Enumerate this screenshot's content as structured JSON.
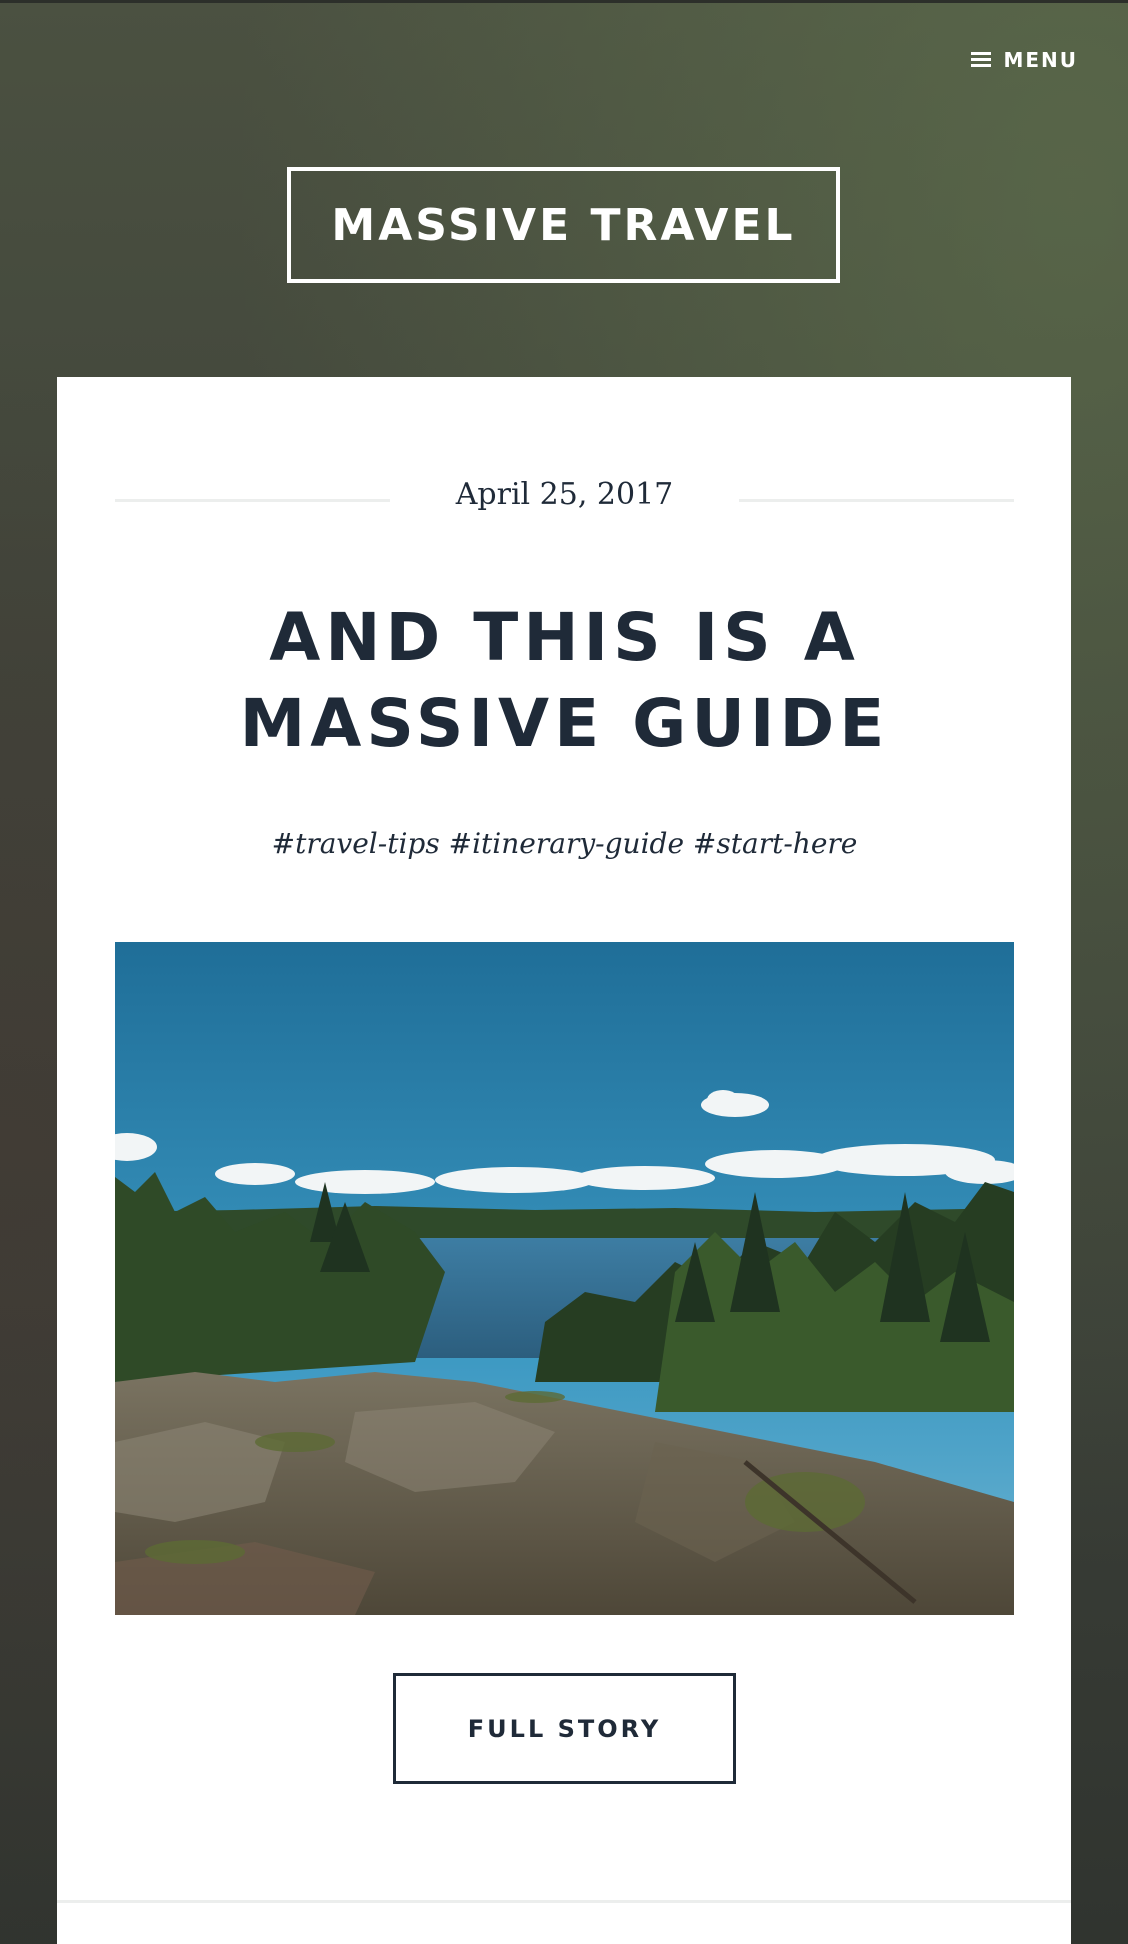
{
  "header": {
    "menu_label": "MENU",
    "site_title": "MASSIVE TRAVEL"
  },
  "post": {
    "date": "April 25, 2017",
    "title": "AND THIS IS A MASSIVE GUIDE",
    "tags": [
      "#travel-tips",
      "#itinerary-guide",
      "#start-here"
    ],
    "image_subject": "lake-landscape-photo",
    "cta_label": "FULL STORY"
  }
}
